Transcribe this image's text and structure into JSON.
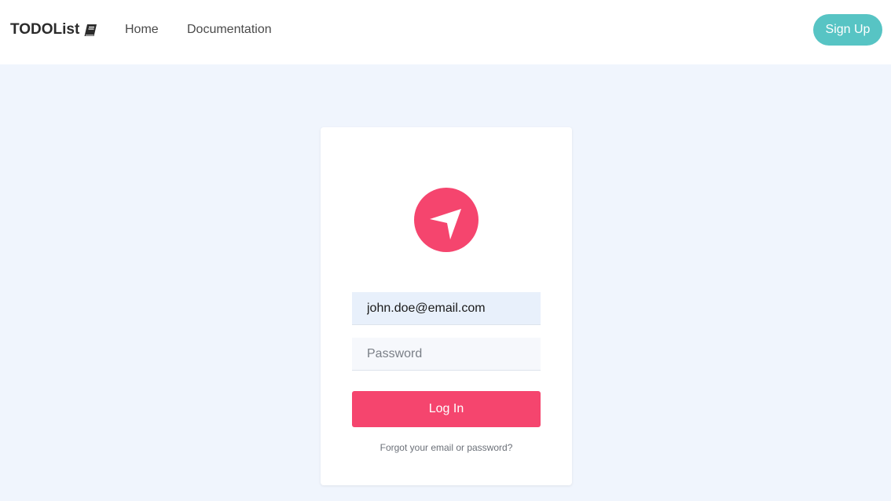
{
  "navbar": {
    "brand": "TODOList",
    "brand_icon": "book-icon",
    "links": [
      "Home",
      "Documentation"
    ],
    "signup_label": "Sign Up",
    "signup_color": "#57c4c4"
  },
  "login": {
    "logo_icon": "paper-plane-icon",
    "email_value": "john.doe@email.com",
    "password_placeholder": "Password",
    "login_label": "Log In",
    "forgot_label": "Forgot your email or password?",
    "accent_color": "#f5456e"
  }
}
